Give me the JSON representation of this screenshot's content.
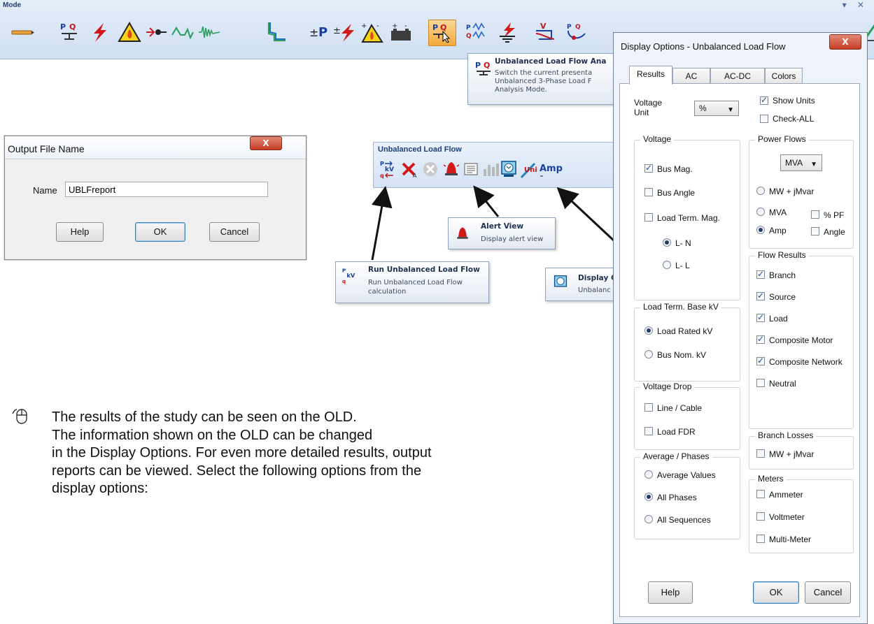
{
  "mode_toolbar": {
    "title": "Mode",
    "window_controls": "▾ ✕",
    "icons": [
      "edit-icon",
      "load-flow-icon",
      "short-circuit-icon",
      "arc-flash-icon",
      "motor-starting-icon",
      "harmonic-icon",
      "transient-stability-icon",
      "protective-coordination-icon",
      "optimal-power-flow-icon",
      "reliability-icon",
      "dc-arc-flash-icon",
      "battery-sizing-icon",
      "unbalanced-load-flow-icon",
      "contingency-icon",
      "grounding-icon",
      "cable-pulling-icon",
      "dc-load-flow-icon",
      "more-icon"
    ]
  },
  "mode_tooltip": {
    "title": "Unbalanced Load Flow Ana",
    "desc_lines": [
      "Switch the current presenta",
      "Unbalanced 3-Phase Load F",
      "Analysis Mode."
    ]
  },
  "output_dialog": {
    "title": "Output File Name",
    "close": "X",
    "name_label": "Name",
    "name_value": "UBLFreport",
    "help": "Help",
    "ok": "OK",
    "cancel": "Cancel"
  },
  "ulf_toolbar": {
    "title": "Unbalanced Load Flow",
    "unit_label": "Unit",
    "amp_label": "Amp"
  },
  "callouts": {
    "alert": {
      "title": "Alert View",
      "desc": "Display alert view"
    },
    "run": {
      "title": "Run Unbalanced Load Flow",
      "desc_lines": [
        "Run Unbalanced Load Flow",
        "calculation"
      ]
    },
    "display": {
      "title": "Display C",
      "desc": "Unbalanc"
    }
  },
  "body_text": [
    "The results of the study can be seen on the OLD.",
    "The information shown on the OLD can be changed",
    "in the Display Options. For even more detailed results, output",
    "reports can be viewed. Select the following options from the",
    "display options:"
  ],
  "display_options": {
    "title": "Display Options - Unbalanced Load Flow",
    "close": "X",
    "tabs": [
      "Results",
      "AC",
      "AC-DC",
      "Colors"
    ],
    "voltage_unit_label": [
      "Voltage",
      "Unit"
    ],
    "voltage_unit_value": "%",
    "show_units": "Show Units",
    "check_all": "Check-ALL",
    "voltage": {
      "label": "Voltage",
      "bus_mag": "Bus Mag.",
      "bus_angle": "Bus Angle",
      "load_term_mag": "Load Term. Mag.",
      "ln": "L- N",
      "ll": "L- L"
    },
    "power_flows": {
      "label": "Power Flows",
      "unit": "MVA",
      "mw_jmvar": "MW + jMvar",
      "mva": "MVA",
      "amp": "Amp",
      "pf": "% PF",
      "angle": "Angle"
    },
    "flow_results": {
      "label": "Flow Results",
      "branch": "Branch",
      "source": "Source",
      "load": "Load",
      "composite_motor": "Composite Motor",
      "composite_network": "Composite Network",
      "neutral": "Neutral"
    },
    "load_term_base": {
      "label": "Load Term. Base kV",
      "rated": "Load Rated kV",
      "nom": "Bus Nom. kV"
    },
    "voltage_drop": {
      "label": "Voltage Drop",
      "line_cable": "Line / Cable",
      "load_fdr": "Load FDR"
    },
    "branch_losses": {
      "label": "Branch Losses",
      "mw_jmvar": "MW + jMvar"
    },
    "avg_phases": {
      "label": "Average / Phases",
      "avg": "Average Values",
      "all_phases": "All Phases",
      "all_seq": "All Sequences"
    },
    "meters": {
      "label": "Meters",
      "ammeter": "Ammeter",
      "voltmeter": "Voltmeter",
      "multimeter": "Multi-Meter"
    },
    "help": "Help",
    "ok": "OK",
    "cancel": "Cancel"
  }
}
